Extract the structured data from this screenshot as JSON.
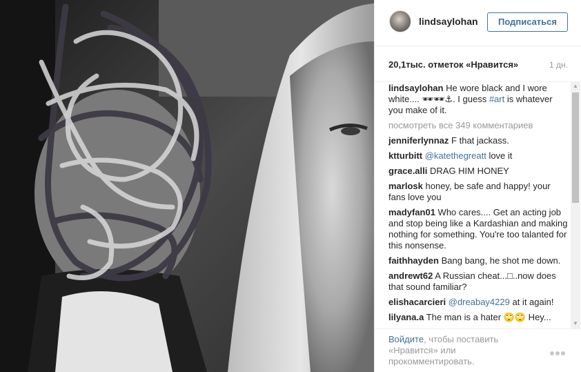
{
  "post": {
    "username": "lindsaylohan",
    "follow_label": "Подписаться",
    "likes": "20,1тыс. отметок «Нравится»",
    "time": "1 дн.",
    "caption": {
      "user": "lindsaylohan",
      "text_1": "He wore black and I wore white.... 🕶🕶⚓. I guess ",
      "hashtag": "#art",
      "text_2": " is whatever you make of it."
    },
    "view_all": "посмотреть все 349 комментариев",
    "comments": [
      {
        "user": "jenniferlynnaz",
        "pre": "F that jackass.",
        "mention": "",
        "post": ""
      },
      {
        "user": "ktturbitt",
        "pre": "",
        "mention": "@katethegreatt",
        "post": " love it"
      },
      {
        "user": "grace.alli",
        "pre": "DRAG HIM HONEY",
        "mention": "",
        "post": ""
      },
      {
        "user": "marlosk",
        "pre": "honey, be safe and happy! your fans love you",
        "mention": "",
        "post": ""
      },
      {
        "user": "madyfan01",
        "pre": "Who cares.... Get an acting job and stop being like a Kardashian and making nothing for something. You're too talanted for this nonsense.",
        "mention": "",
        "post": ""
      },
      {
        "user": "faithhayden",
        "pre": "Bang bang, he shot me down.",
        "mention": "",
        "post": ""
      },
      {
        "user": "andrewt62",
        "pre": "A Russian cheat...□..now does that sound familiar?",
        "mention": "",
        "post": ""
      },
      {
        "user": "elishacarcieri",
        "pre": "",
        "mention": "@dreabay4229",
        "post": " at it again!"
      },
      {
        "user": "lilyana.a",
        "pre": "The man is a hater 🙄🙄 Hey...",
        "mention": "",
        "post": ""
      }
    ],
    "footer": {
      "login_link": "Войдите",
      "login_rest": ", чтобы поставить «Нравится» или прокомментировать."
    }
  }
}
